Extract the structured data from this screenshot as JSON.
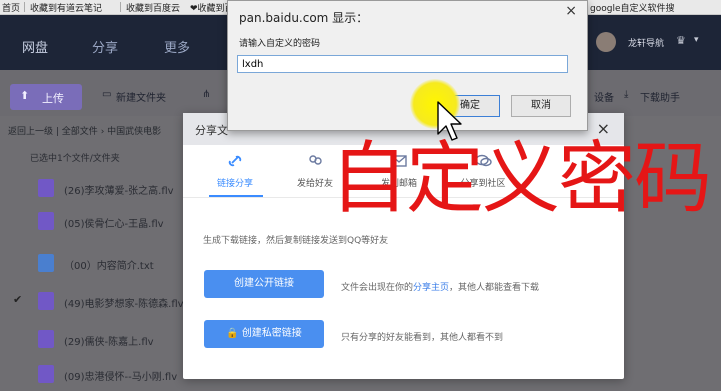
{
  "bookmarks": {
    "items": [
      "首页",
      "收藏到有道云笔记",
      "收藏到百度云",
      "❤收藏到百度云",
      "google自定义软件搜"
    ]
  },
  "header": {
    "nav": [
      "网盘",
      "分享",
      "更多"
    ],
    "username": "龙轩导航"
  },
  "toolbar": {
    "upload": "上传",
    "new_folder": "新建文件夹",
    "device": "设备",
    "downloads": "下载助手"
  },
  "breadcrumb": {
    "back": "返回上一级",
    "all": "全部文件",
    "current": "中国武侠电影"
  },
  "selection_text": "已选中1个文件/文件夹",
  "files": [
    {
      "name": "(26)李攻薄爱-张之高.flv",
      "icon": "video-icon",
      "checked": false
    },
    {
      "name": "(05)侯骨仁心-王晶.flv",
      "icon": "video-icon",
      "checked": false
    },
    {
      "name": "（00）内容简介.txt",
      "icon": "text-file-icon",
      "checked": false
    },
    {
      "name": "(49)电影梦想家-陈德森.flv",
      "icon": "video-icon",
      "checked": true
    },
    {
      "name": "(29)儒侠-陈嘉上.flv",
      "icon": "video-icon",
      "checked": false
    },
    {
      "name": "(09)忠港侵怀--马小刚.flv",
      "icon": "video-icon",
      "checked": false
    }
  ],
  "share_dialog": {
    "title": "分享文",
    "close": "×",
    "tabs": [
      "链接分享",
      "发给好友",
      "发到邮箱",
      "分享到社区"
    ],
    "description": "生成下载链接，然后复制链接发送到QQ等好友",
    "public_btn": "创建公开链接",
    "public_hint_prefix": "文件会出现在你的",
    "public_hint_link": "分享主页",
    "public_hint_suffix": "，其他人都能查看下载",
    "private_btn": "创建私密链接",
    "private_hint": "只有分享的好友能看到，其他人都看不到"
  },
  "prompt": {
    "title": "pan.baidu.com 显示：",
    "close": "×",
    "message": "请输入自定义的密码",
    "input_value": "lxdh",
    "ok": "确定",
    "cancel": "取消"
  },
  "overlay_caption": "自定义密码",
  "colors": {
    "accent": "#4a8ff0",
    "header_bg": "#1d2537",
    "overlay_text": "#e51616",
    "highlight": "#f6ea1f"
  }
}
